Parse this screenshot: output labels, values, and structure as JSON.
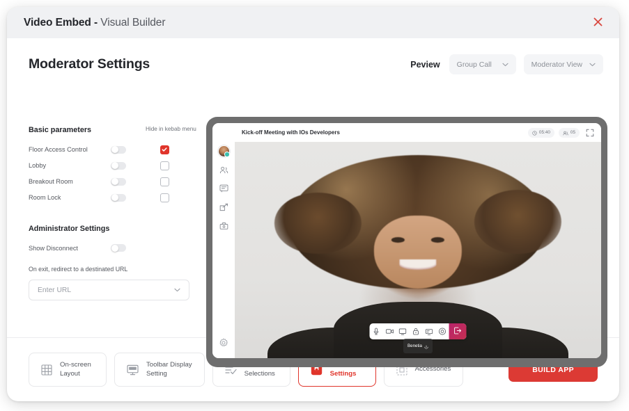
{
  "window": {
    "title_strong": "Video Embed",
    "title_dash": " - ",
    "title_light": "Visual Builder",
    "close_icon": "close-icon"
  },
  "page": {
    "heading": "Moderator Settings"
  },
  "preview": {
    "label": "Peview",
    "call_type": "Group Call",
    "view_mode": "Moderator View"
  },
  "settings": {
    "basic_title": "Basic parameters",
    "kebab_header": "Hide in kebab menu",
    "rows": [
      {
        "label": "Floor Access Control",
        "toggle_on": false,
        "checked": true
      },
      {
        "label": "Lobby",
        "toggle_on": false,
        "checked": false
      },
      {
        "label": "Breakout Room",
        "toggle_on": false,
        "checked": false
      },
      {
        "label": "Room Lock",
        "toggle_on": false,
        "checked": false
      }
    ],
    "admin_title": "Administrator Settings",
    "show_disconnect_label": "Show Disconnect",
    "show_disconnect_on": false,
    "exit_note": "On exit, redirect to a destinated URL",
    "url_value": "",
    "url_placeholder": "Enter URL"
  },
  "video": {
    "meeting_title": "Kick-off Meeting with IOs Developers",
    "timer": "05:40",
    "participants": "05",
    "name_tag": "Benetia",
    "rail": [
      {
        "name": "avatar",
        "label": "avatar"
      },
      {
        "name": "participants-icon",
        "label": "Participants"
      },
      {
        "name": "chat-icon",
        "label": "Chat"
      },
      {
        "name": "share-icon",
        "label": "Share"
      },
      {
        "name": "presentation-icon",
        "label": "Presentation"
      }
    ],
    "rail_bottom": {
      "name": "gear-icon",
      "label": "Settings"
    },
    "toolbar": [
      {
        "name": "microphone-icon",
        "label": "Microphone"
      },
      {
        "name": "camera-icon",
        "label": "Camera"
      },
      {
        "name": "screen-share-icon",
        "label": "Screen Share"
      },
      {
        "name": "lock-icon",
        "label": "Lock"
      },
      {
        "name": "present-icon",
        "label": "Present"
      },
      {
        "name": "record-icon",
        "label": "Record"
      }
    ],
    "leave_label": "Leave"
  },
  "footer": {
    "tabs": [
      {
        "label": "On-screen\nLayout",
        "icon": "grid-icon",
        "active": false
      },
      {
        "label": "Toolbar Display\nSetting",
        "icon": "monitor-icon",
        "active": false
      },
      {
        "label": "Feature\nSelections",
        "icon": "checklist-icon",
        "active": false
      },
      {
        "label": "Moderator\nSettings",
        "icon": "moderator-gear-icon",
        "active": true
      },
      {
        "label": "Accessories",
        "icon": "accessories-icon",
        "active": false
      }
    ],
    "build_label": "BUILD APP"
  },
  "colors": {
    "accent_red": "#dc3a34",
    "checkbox_red": "#e0352b",
    "leave_magenta": "#b9246b",
    "titlebar_bg": "#f0f1f3",
    "bezel_gray": "#6e6e6e"
  }
}
